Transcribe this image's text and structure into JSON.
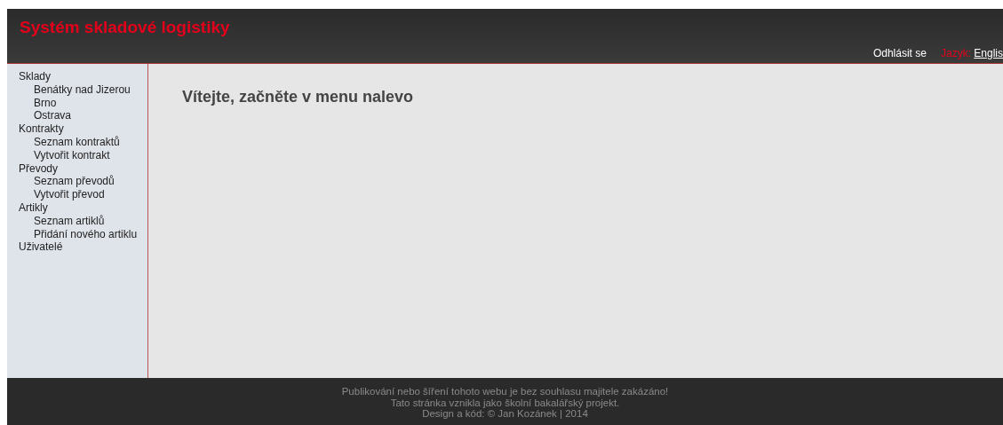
{
  "header": {
    "title": "Systém skladové logistiky",
    "logout": "Odhlásit se",
    "language_label": "Jazyk:",
    "language_link": "Englis"
  },
  "sidebar": {
    "items": [
      {
        "label": "Sklady",
        "children": [
          {
            "label": "Benátky nad Jizerou"
          },
          {
            "label": "Brno"
          },
          {
            "label": "Ostrava"
          }
        ]
      },
      {
        "label": "Kontrakty",
        "children": [
          {
            "label": "Seznam kontraktů"
          },
          {
            "label": "Vytvořit kontrakt"
          }
        ]
      },
      {
        "label": "Převody",
        "children": [
          {
            "label": "Seznam převodů"
          },
          {
            "label": "Vytvořit převod"
          }
        ]
      },
      {
        "label": "Artikly",
        "children": [
          {
            "label": "Seznam artiklů"
          },
          {
            "label": "Přidání nového artiklu"
          }
        ]
      },
      {
        "label": "Uživatelé"
      }
    ]
  },
  "content": {
    "heading": "Vítejte, začněte v menu nalevo"
  },
  "footer": {
    "lines": [
      "Publikování nebo šíření tohoto webu je bez souhlasu majitele zakázáno!",
      "Tato stránka vznikla jako školní bakalářský projekt.",
      "Design a kód: © Jan Kozánek | 2014"
    ]
  }
}
